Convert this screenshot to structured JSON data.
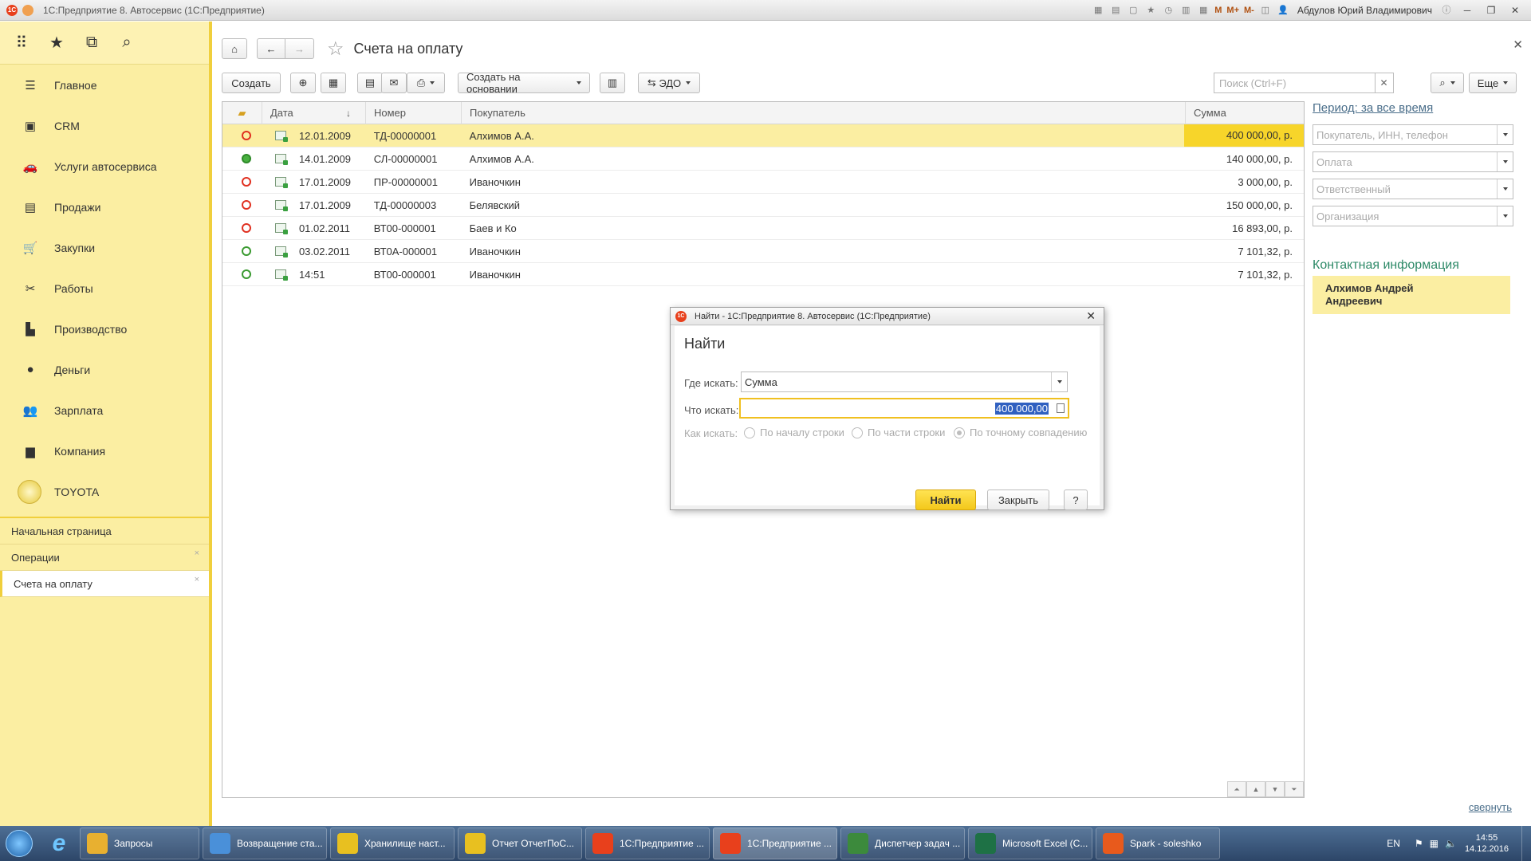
{
  "titlebar": {
    "title": "1С:Предприятие 8. Автосервис  (1С:Предприятие)",
    "user": "Абдулов Юрий Владимирович",
    "m_labels": [
      "M",
      "M+",
      "M-"
    ]
  },
  "sidebar": {
    "items": [
      {
        "label": "Главное",
        "icon": "menu-lines-icon"
      },
      {
        "label": "CRM",
        "icon": "crm-icon"
      },
      {
        "label": "Услуги автосервиса",
        "icon": "car-icon"
      },
      {
        "label": "Продажи",
        "icon": "bag-icon"
      },
      {
        "label": "Закупки",
        "icon": "cart-icon"
      },
      {
        "label": "Работы",
        "icon": "tools-icon"
      },
      {
        "label": "Производство",
        "icon": "factory-icon"
      },
      {
        "label": "Деньги",
        "icon": "coin-icon"
      },
      {
        "label": "Зарплата",
        "icon": "people-icon"
      },
      {
        "label": "Компания",
        "icon": "briefcase-icon"
      },
      {
        "label": "TOYOTA",
        "icon": "toyota-logo"
      }
    ],
    "open_tabs": [
      "Начальная страница",
      "Операции",
      "Счета на оплату"
    ]
  },
  "page": {
    "title": "Счета на оплату"
  },
  "toolbar": {
    "create": "Создать",
    "create_based_on": "Создать на основании",
    "edo": "ЭДО",
    "search_placeholder": "Поиск (Ctrl+F)",
    "more": "Еще"
  },
  "table": {
    "columns": {
      "date": "Дата",
      "number": "Номер",
      "buyer": "Покупатель",
      "sum": "Сумма"
    },
    "rows": [
      {
        "status": "red-open",
        "date": "12.01.2009",
        "number": "ТД-00000001",
        "buyer": "Алхимов А.А.",
        "sum": "400 000,00, р."
      },
      {
        "status": "green-filled",
        "date": "14.01.2009",
        "number": "СЛ-00000001",
        "buyer": "Алхимов А.А.",
        "sum": "140 000,00, р."
      },
      {
        "status": "red-open",
        "date": "17.01.2009",
        "number": "ПР-00000001",
        "buyer": "Иваночкин",
        "sum": "3 000,00, р."
      },
      {
        "status": "red-clock",
        "date": "17.01.2009",
        "number": "ТД-00000003",
        "buyer": "Белявский",
        "sum": "150 000,00, р."
      },
      {
        "status": "red-open",
        "date": "01.02.2011",
        "number": "ВТ00-000001",
        "buyer": "Баев и Ко",
        "sum": "16 893,00, р."
      },
      {
        "status": "green-open",
        "date": "03.02.2011",
        "number": "ВТ0А-000001",
        "buyer": "Иваночкин",
        "sum": "7 101,32, р."
      },
      {
        "status": "green-open",
        "date": "14:51",
        "number": "ВТ00-000001",
        "buyer": "Иваночкин",
        "sum": "7 101,32, р."
      }
    ]
  },
  "right_panel": {
    "period": "Период: за все время",
    "filters": [
      "Покупатель, ИНН, телефон",
      "Оплата",
      "Ответственный",
      "Организация"
    ],
    "contact_header": "Контактная информация",
    "contact_name_1": "Алхимов Андрей",
    "contact_name_2": "Андреевич",
    "collapse": "свернуть"
  },
  "dialog": {
    "title": "Найти - 1С:Предприятие 8. Автосервис  (1С:Предприятие)",
    "heading": "Найти",
    "where_label": "Где искать:",
    "where_value": "Сумма",
    "what_label": "Что искать:",
    "what_value": "400 000,00",
    "how_label": "Как искать:",
    "options": [
      "По началу строки",
      "По части строки",
      "По точному совпадению"
    ],
    "find_btn": "Найти",
    "close_btn": "Закрыть",
    "help_btn": "?"
  },
  "taskbar": {
    "tasks": [
      {
        "label": "Запросы",
        "color": "#e8b030",
        "w": 150
      },
      {
        "label": "Возвращение ста...",
        "color": "#4a90d9",
        "w": 156
      },
      {
        "label": "Хранилище наст...",
        "color": "#e8c020",
        "w": 156
      },
      {
        "label": "Отчет ОтчетПоС...",
        "color": "#e8c020",
        "w": 156
      },
      {
        "label": "1С:Предприятие ...",
        "color": "#e8401c",
        "w": 156
      },
      {
        "label": "1С:Предприятие ...",
        "color": "#e8401c",
        "w": 156
      },
      {
        "label": "Диспетчер задач ...",
        "color": "#3c8a3c",
        "w": 156
      },
      {
        "label": "Microsoft Excel (С...",
        "color": "#1e7145",
        "w": 156
      },
      {
        "label": "Spark - soleshko",
        "color": "#e85a1c",
        "w": 156
      }
    ],
    "lang": "EN",
    "time": "14:55",
    "date": "14.12.2016"
  }
}
